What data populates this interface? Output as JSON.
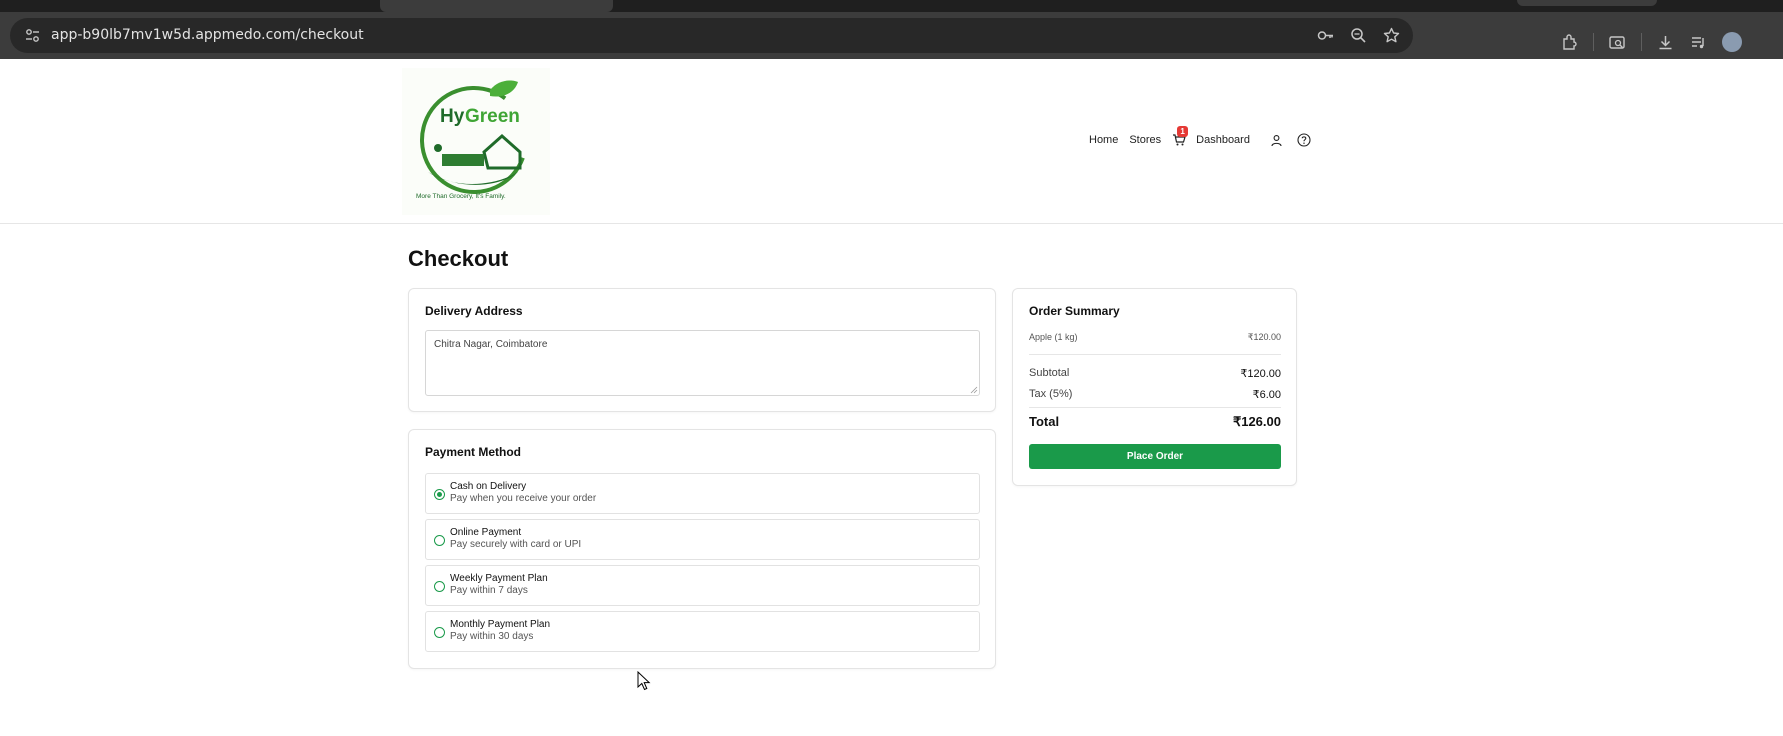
{
  "browser": {
    "url": "app-b90lb7mv1w5d.appmedo.com/checkout"
  },
  "header": {
    "logo_text": "HyGreen",
    "logo_tagline": "More Than Grocery, It's Family.",
    "nav": {
      "home": "Home",
      "stores": "Stores",
      "cart_count": "1",
      "dashboard": "Dashboard"
    }
  },
  "page": {
    "title": "Checkout"
  },
  "delivery": {
    "title": "Delivery Address",
    "address": "Chitra Nagar, Coimbatore"
  },
  "payment": {
    "title": "Payment Method",
    "options": [
      {
        "title": "Cash on Delivery",
        "subtitle": "Pay when you receive your order",
        "selected": true
      },
      {
        "title": "Online Payment",
        "subtitle": "Pay securely with card or UPI",
        "selected": false
      },
      {
        "title": "Weekly Payment Plan",
        "subtitle": "Pay within 7 days",
        "selected": false
      },
      {
        "title": "Monthly Payment Plan",
        "subtitle": "Pay within 30 days",
        "selected": false
      }
    ]
  },
  "summary": {
    "title": "Order Summary",
    "items": [
      {
        "name": "Apple (1 kg)",
        "price": "₹120.00"
      }
    ],
    "subtotal_label": "Subtotal",
    "subtotal": "₹120.00",
    "tax_label": "Tax (5%)",
    "tax": "₹6.00",
    "total_label": "Total",
    "total": "₹126.00",
    "place_order": "Place Order"
  },
  "colors": {
    "brand_green": "#1a9a4a",
    "badge_red": "#e53935"
  }
}
